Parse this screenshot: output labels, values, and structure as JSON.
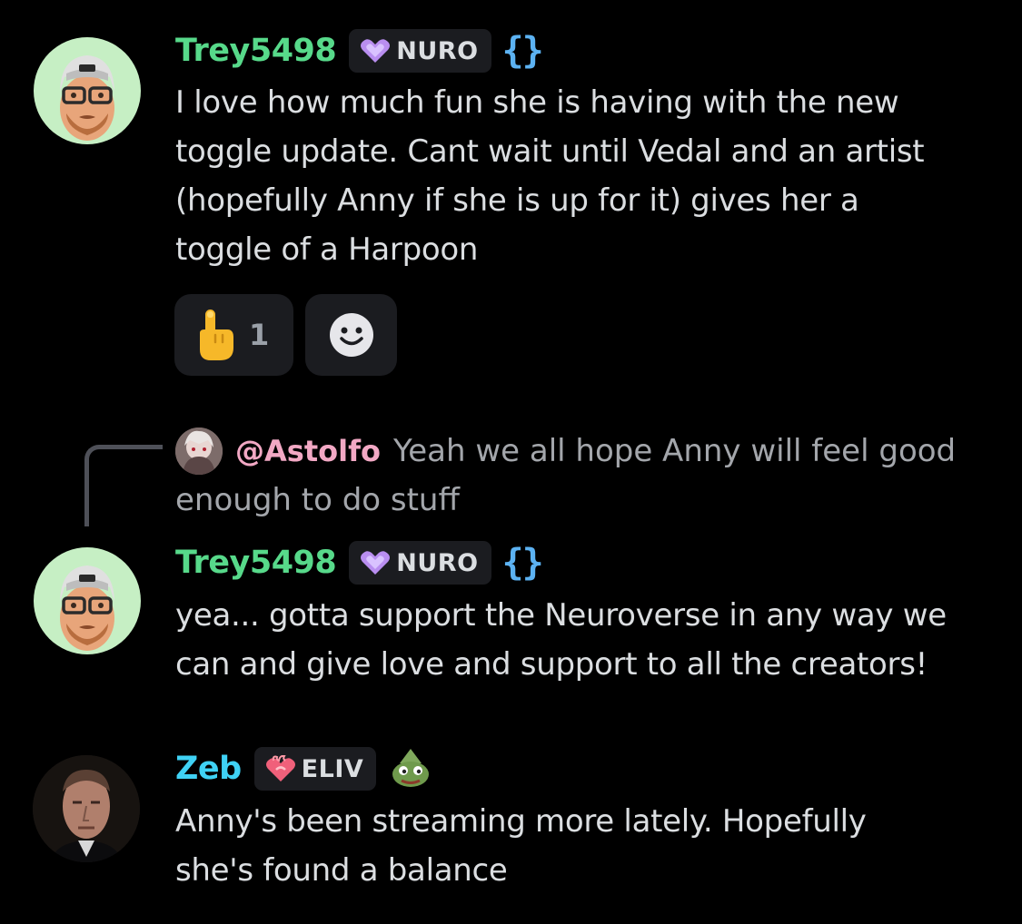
{
  "messages": [
    {
      "username": "Trey5498",
      "username_color": "#57d98a",
      "tag": "NURO",
      "tag_icon": "purple-heart-icon",
      "decoration": "{}",
      "lines": [
        "I love how much fun she is having with the new",
        "toggle update.  Cant wait until Vedal and an artist",
        "(hopefully Anny if she is up for it) gives her a",
        "toggle of a Harpoon"
      ],
      "reactions": [
        {
          "emoji": "pointing-up-hand-icon",
          "count": "1"
        },
        {
          "emoji": "add-reaction-smiley-icon",
          "count": ""
        }
      ]
    },
    {
      "reply": {
        "mention": "@Astolfo",
        "text_line1": "Yeah we all hope Anny will feel good",
        "text_line2": "enough to do stuff"
      },
      "username": "Trey5498",
      "username_color": "#57d98a",
      "tag": "NURO",
      "tag_icon": "purple-heart-icon",
      "decoration": "{}",
      "lines": [
        "yea...  gotta support the Neuroverse in any way we",
        "can and give love and support to all the creators!"
      ]
    },
    {
      "username": "Zeb",
      "username_color": "#3fd2f5",
      "tag": "ELIV",
      "tag_icon": "pink-flame-heart-icon",
      "decoration_icon": "frog-emoji-icon",
      "lines": [
        "Anny's been streaming more lately.  Hopefully",
        "she's found a balance"
      ]
    }
  ]
}
